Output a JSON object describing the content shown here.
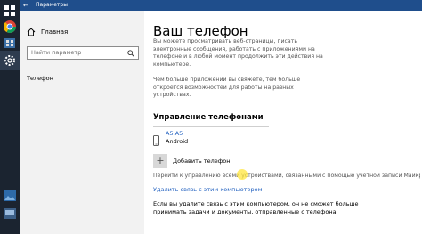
{
  "window": {
    "title": "Параметры"
  },
  "sidebar": {
    "home_label": "Главная",
    "search_placeholder": "Найти параметр",
    "items": [
      {
        "label": "Телефон"
      }
    ]
  },
  "main": {
    "title": "Ваш телефон",
    "intro": "Вы можете просматривать веб-страницы, писать электронные сообщения, работать с приложениями на телефоне и в любой момент продолжить эти действия на компьютере.",
    "more_text": "Чем больше приложений вы свяжете, тем больше откроется возможностей для работы на разных устройствах.",
    "manage_heading": "Управление телефонами",
    "device": {
      "name": "A5 A5",
      "os": "Android"
    },
    "add_phone_label": "Добавить телефон",
    "manage_all_text": "Перейти к управлению всеми устройствами, связанными с помощью учетной записи Майкрософт",
    "unlink_label": "Удалить связь с этим компьютером",
    "warning_text": "Если вы удалите связь с этим компьютером, он не сможет больше принимать задачи и документы, отправленные с телефона."
  },
  "colors": {
    "accent": "#1f5fbf",
    "titlebar": "#1f4e8c",
    "taskbar": "#1b2430"
  },
  "icons": [
    "back-arrow-icon",
    "home-icon",
    "search-icon",
    "phone-icon",
    "plus-icon",
    "settings-gear-icon",
    "chrome-icon",
    "store-icon"
  ]
}
